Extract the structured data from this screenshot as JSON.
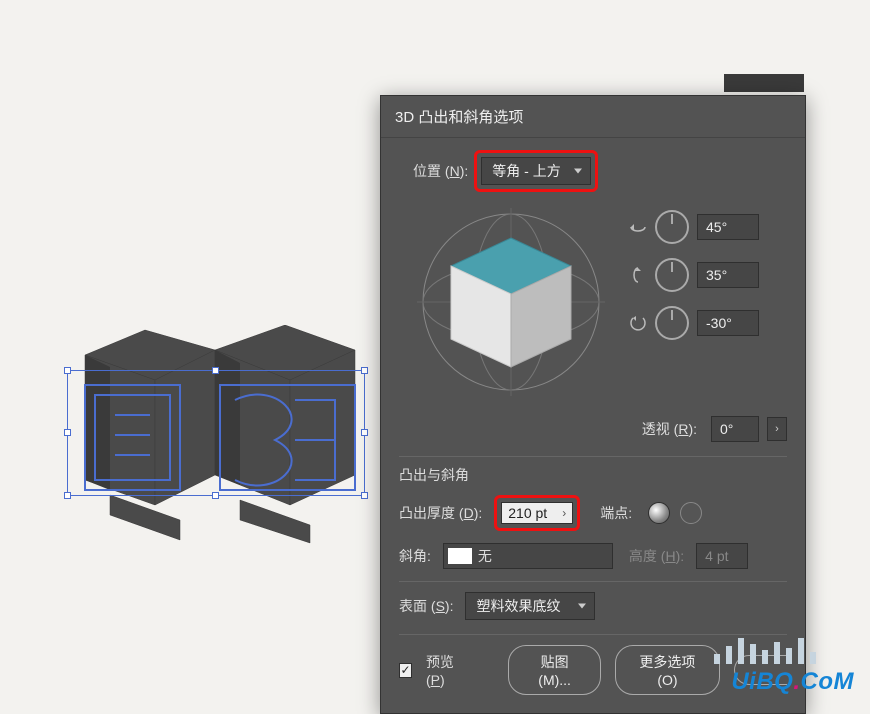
{
  "dialog": {
    "title": "3D 凸出和斜角选项",
    "position": {
      "label_prefix": "位置 (",
      "label_key": "N",
      "label_suffix": "):",
      "value": "等角 - 上方"
    },
    "rotation": {
      "x": "45°",
      "y": "35°",
      "z": "-30°"
    },
    "perspective": {
      "label_prefix": "透视 (",
      "label_key": "R",
      "label_suffix": "):",
      "value": "0°",
      "step_icon": "›"
    },
    "extrude_section": "凸出与斜角",
    "depth": {
      "label_prefix": "凸出厚度 (",
      "label_key": "D",
      "label_suffix": "):",
      "value": "210 pt",
      "step_icon": "›"
    },
    "cap": {
      "label": "端点:"
    },
    "bevel": {
      "label": "斜角:",
      "value": "无",
      "height_label_prefix": "高度 (",
      "height_label_key": "H",
      "height_label_suffix": "):",
      "height_value": "4 pt"
    },
    "surface": {
      "label_prefix": "表面 (",
      "label_key": "S",
      "label_suffix": "):",
      "value": "塑料效果底纹"
    },
    "footer": {
      "preview_prefix": "预览 (",
      "preview_key": "P",
      "preview_suffix": ")",
      "preview_checked": true,
      "map_art": "贴图 (M)...",
      "more_options": "更多选项 (O)"
    }
  },
  "watermark": {
    "text_a": "UiBQ",
    "dot": ".",
    "text_b": "CoM"
  }
}
